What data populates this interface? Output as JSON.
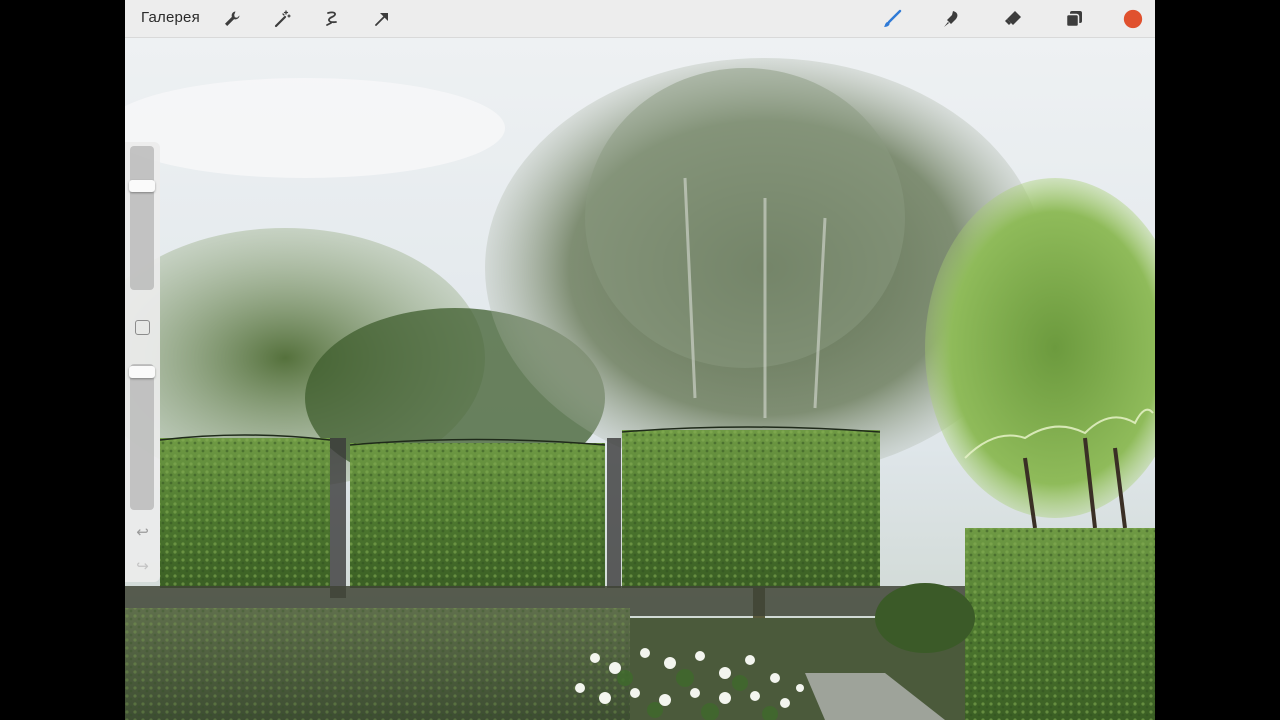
{
  "toolbar": {
    "gallery_label": "Галерея",
    "tools_left": [
      {
        "name": "wrench-icon"
      },
      {
        "name": "magic-wand-icon"
      },
      {
        "name": "selection-icon"
      },
      {
        "name": "transform-arrow-icon"
      }
    ],
    "tools_right": [
      {
        "name": "brush-icon"
      },
      {
        "name": "smudge-icon"
      },
      {
        "name": "eraser-icon"
      },
      {
        "name": "layers-icon"
      },
      {
        "name": "color-picker"
      }
    ]
  },
  "colors": {
    "active_color": "#e0512e",
    "brush_active": "#2f7ad6",
    "toolbar_bg": "#ededed"
  },
  "sidebar": {
    "size_slider_level": 0.77,
    "opacity_slider_level": 0.98,
    "undo_icon": "undo-icon",
    "redo_icon": "redo-icon",
    "modify_button": "modify-square-icon"
  }
}
